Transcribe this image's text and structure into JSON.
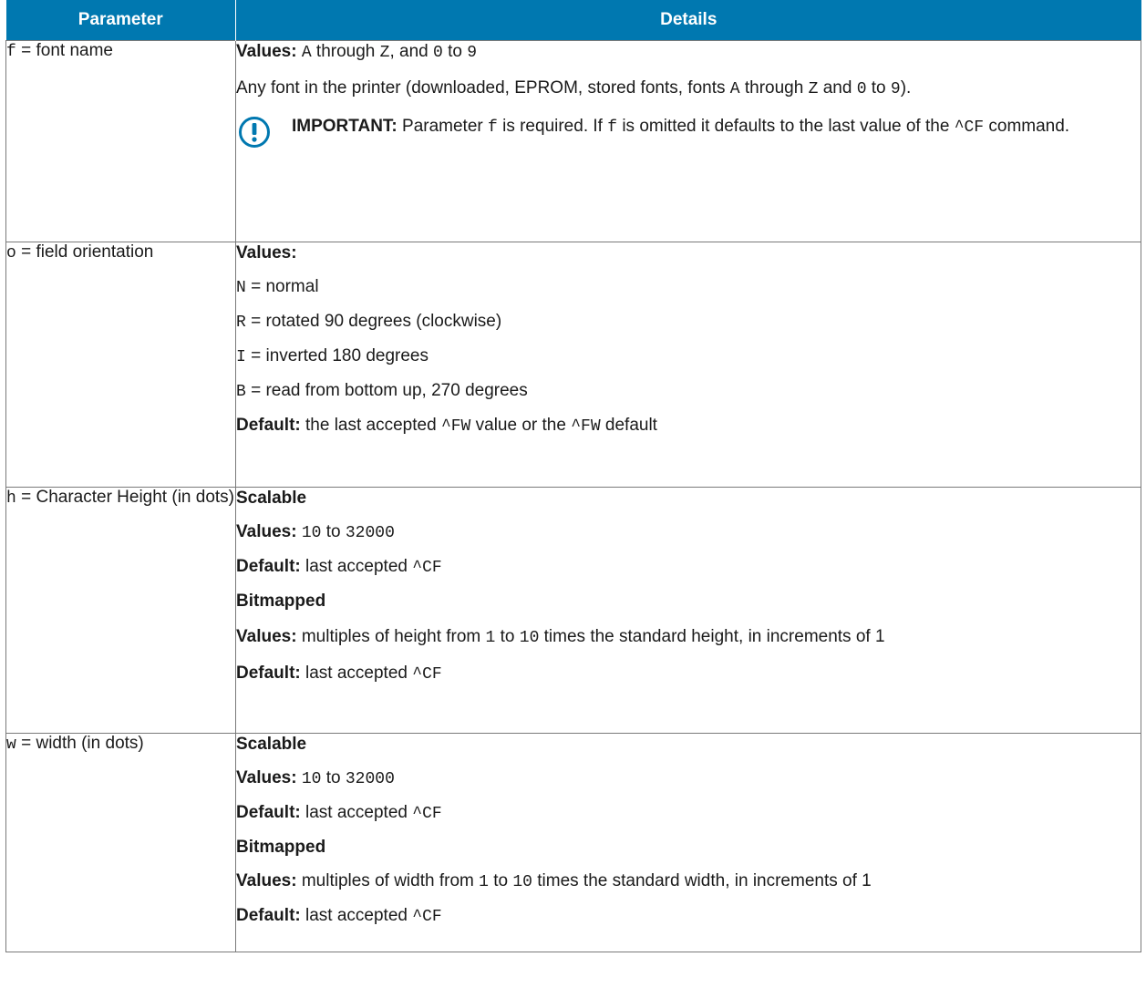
{
  "header": {
    "parameter": "Parameter",
    "details": "Details"
  },
  "rows": {
    "f": {
      "code": "f",
      "label": "= font name",
      "values_label": "Values:",
      "v_a": "A",
      "v_through": "through",
      "v_z": "Z",
      "v_and": ", and",
      "v_0": "0",
      "v_to": "to",
      "v_9": "9",
      "desc_start": "Any font in the printer (downloaded, EPROM, stored fonts, fonts",
      "desc_a": "A",
      "desc_through": "through",
      "desc_z": "Z",
      "desc_and": "and",
      "desc_0": "0",
      "desc_to": "to",
      "desc_9": "9",
      "desc_end": ").",
      "important_label": "IMPORTANT:",
      "imp_1": "Parameter",
      "imp_f1": "f",
      "imp_2": "is required. If",
      "imp_f2": "f",
      "imp_3": "is omitted it defaults to the last value of the",
      "imp_cmd": "^CF",
      "imp_4": "command."
    },
    "o": {
      "code": "o",
      "label": "= field orientation",
      "values_label": "Values:",
      "options": [
        {
          "code": "N",
          "text": "= normal"
        },
        {
          "code": "R",
          "text": "= rotated 90 degrees (clockwise)"
        },
        {
          "code": "I",
          "text": "= inverted 180 degrees"
        },
        {
          "code": "B",
          "text": "= read from bottom up, 270 degrees"
        }
      ],
      "default_label": "Default:",
      "default_1": "the last accepted",
      "default_cmd1": "^FW",
      "default_2": "value or the",
      "default_cmd2": "^FW",
      "default_3": "default"
    },
    "h": {
      "code": "h",
      "label": "= Character Height (in dots)",
      "scalable": "Scalable",
      "values_label": "Values:",
      "s_min": "10",
      "s_to": "to",
      "s_max": "32000",
      "default_label": "Default:",
      "default_text": "last accepted",
      "default_cmd": "^CF",
      "bitmapped": "Bitmapped",
      "b_values_label": "Values:",
      "b_1": "multiples of height from",
      "b_min": "1",
      "b_to": "to",
      "b_max": "10",
      "b_2": "times the standard height, in increments of 1",
      "b_default_label": "Default:",
      "b_default_text": "last accepted",
      "b_default_cmd": "^CF"
    },
    "w": {
      "code": "w",
      "label": "= width (in dots)",
      "scalable": "Scalable",
      "values_label": "Values:",
      "s_min": "10",
      "s_to": "to",
      "s_max": "32000",
      "default_label": "Default:",
      "default_text": "last accepted",
      "default_cmd": "^CF",
      "bitmapped": "Bitmapped",
      "b_values_label": "Values:",
      "b_1": "multiples of width from",
      "b_min": "1",
      "b_to": "to",
      "b_max": "10",
      "b_2": "times the standard width, in increments of 1",
      "b_default_label": "Default:",
      "b_default_text": "last accepted",
      "b_default_cmd": "^CF"
    }
  },
  "colors": {
    "header_bg": "#0078b0",
    "icon": "#0078b0",
    "border": "#7a7a7a"
  },
  "icons": {
    "important": "exclamation-circle-icon"
  }
}
